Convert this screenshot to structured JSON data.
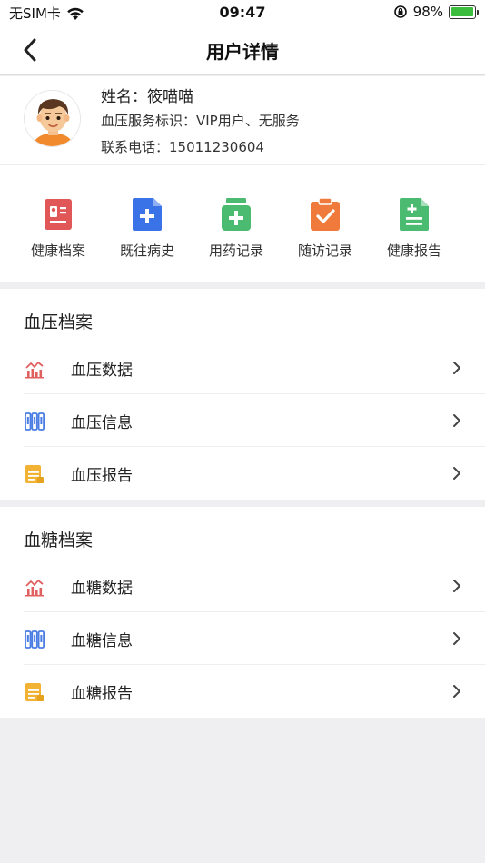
{
  "status_bar": {
    "carrier": "无SIM卡",
    "time": "09:47",
    "battery": "98%",
    "battery_level": 0.98
  },
  "nav": {
    "title": "用户详情"
  },
  "profile": {
    "name": "姓名：筱喵喵",
    "tag": "血压服务标识：VIP用户、无服务",
    "phone": "联系电话：15011230604"
  },
  "shortcuts": [
    {
      "label": "健康档案",
      "icon": "health-record-icon",
      "color": "#e15656"
    },
    {
      "label": "既往病史",
      "icon": "medical-history-icon",
      "color": "#3a72e8"
    },
    {
      "label": "用药记录",
      "icon": "medication-icon",
      "color": "#4cbb72"
    },
    {
      "label": "随访记录",
      "icon": "follow-up-icon",
      "color": "#ef7a3b"
    },
    {
      "label": "健康报告",
      "icon": "health-report-icon",
      "color": "#4cbb72"
    }
  ],
  "bp_section": {
    "title": "血压档案",
    "items": [
      {
        "label": "血压数据",
        "icon": "chart-icon"
      },
      {
        "label": "血压信息",
        "icon": "info-icon"
      },
      {
        "label": "血压报告",
        "icon": "report-icon"
      }
    ]
  },
  "bg_section": {
    "title": "血糖档案",
    "items": [
      {
        "label": "血糖数据",
        "icon": "chart-icon"
      },
      {
        "label": "血糖信息",
        "icon": "info-icon"
      },
      {
        "label": "血糖报告",
        "icon": "report-icon"
      }
    ]
  }
}
